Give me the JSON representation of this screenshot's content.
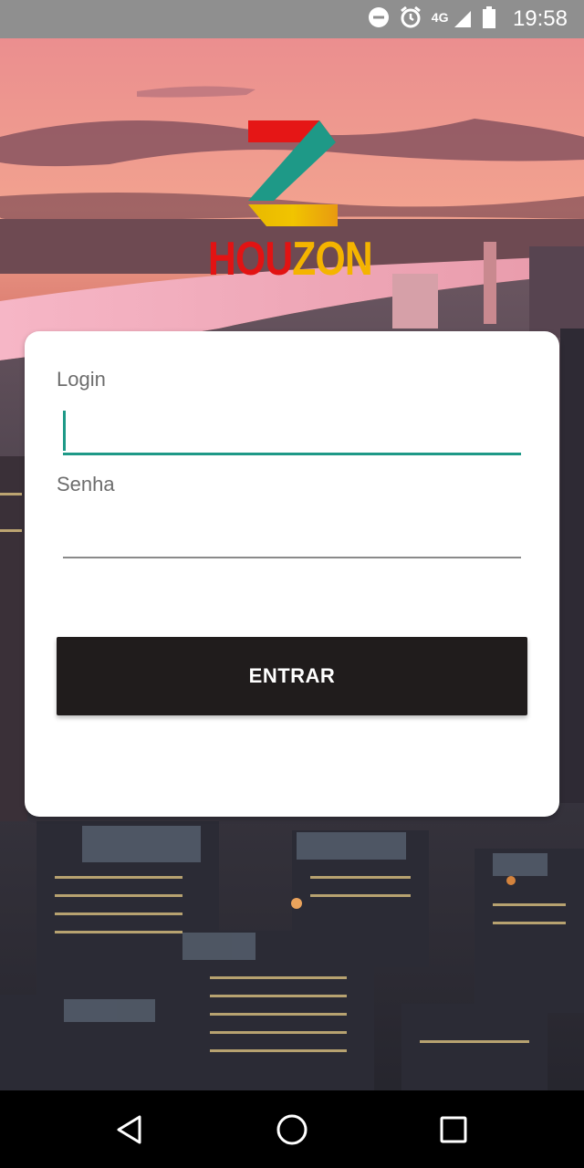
{
  "status_bar": {
    "time": "19:58",
    "network_type": "4G",
    "icons": [
      "do-not-disturb-icon",
      "alarm-icon",
      "signal-icon",
      "battery-icon"
    ]
  },
  "logo": {
    "text_part1": "HOU",
    "text_part2": "ZON",
    "colors": {
      "red": "#e21313",
      "yellow": "#f4b400",
      "green": "#1e9987"
    }
  },
  "login_form": {
    "login_label": "Login",
    "login_value": "",
    "password_label": "Senha",
    "password_value": "",
    "submit_label": "ENTRAR"
  },
  "nav_bar": {
    "buttons": [
      "back-icon",
      "home-icon",
      "recents-icon"
    ]
  },
  "theme": {
    "accent": "#1e9987",
    "button_bg": "#201c1c",
    "status_bar_bg": "#8f8f8f"
  }
}
